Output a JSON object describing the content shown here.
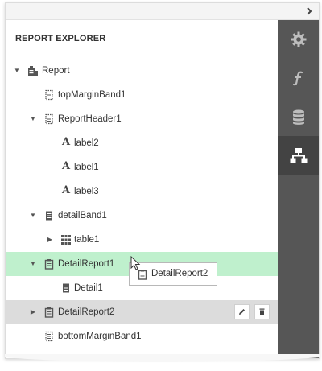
{
  "topbar": {
    "collapse_glyph": ">"
  },
  "explorer": {
    "title": "REPORT EXPLORER"
  },
  "tree": [
    {
      "label": "Report",
      "icon": "report-icon",
      "expander": "expanded"
    },
    {
      "label": "topMarginBand1",
      "icon": "band-icon",
      "expander": "none"
    },
    {
      "label": "ReportHeader1",
      "icon": "band-icon",
      "expander": "expanded"
    },
    {
      "label": "label2",
      "icon": "label-icon",
      "expander": "none"
    },
    {
      "label": "label1",
      "icon": "label-icon",
      "expander": "none"
    },
    {
      "label": "label3",
      "icon": "label-icon",
      "expander": "none"
    },
    {
      "label": "detailBand1",
      "icon": "detail-band-icon",
      "expander": "expanded"
    },
    {
      "label": "table1",
      "icon": "table-icon",
      "expander": "collapsed"
    },
    {
      "label": "DetailReport1",
      "icon": "detail-report-icon",
      "expander": "expanded",
      "state": "selected"
    },
    {
      "label": "Detail1",
      "icon": "detail-band-icon",
      "expander": "none"
    },
    {
      "label": "DetailReport2",
      "icon": "detail-report-icon",
      "expander": "collapsed",
      "state": "hovered"
    },
    {
      "label": "bottomMarginBand1",
      "icon": "band-icon",
      "expander": "none"
    }
  ],
  "drag_ghost": {
    "label": "DetailReport2",
    "icon": "detail-report-icon"
  },
  "right_panel": {
    "tabs": [
      {
        "name": "properties",
        "icon": "gear-icon"
      },
      {
        "name": "expressions",
        "icon": "function-icon"
      },
      {
        "name": "data-source",
        "icon": "database-icon"
      },
      {
        "name": "report-explorer",
        "icon": "hierarchy-icon",
        "active": true
      }
    ]
  },
  "row_actions": [
    "edit-icon",
    "delete-icon"
  ],
  "colors": {
    "selected_row": "#bff0cd",
    "hovered_row": "#dcdcdc",
    "right_panel_bg": "#565656",
    "right_panel_active": "#434343"
  }
}
